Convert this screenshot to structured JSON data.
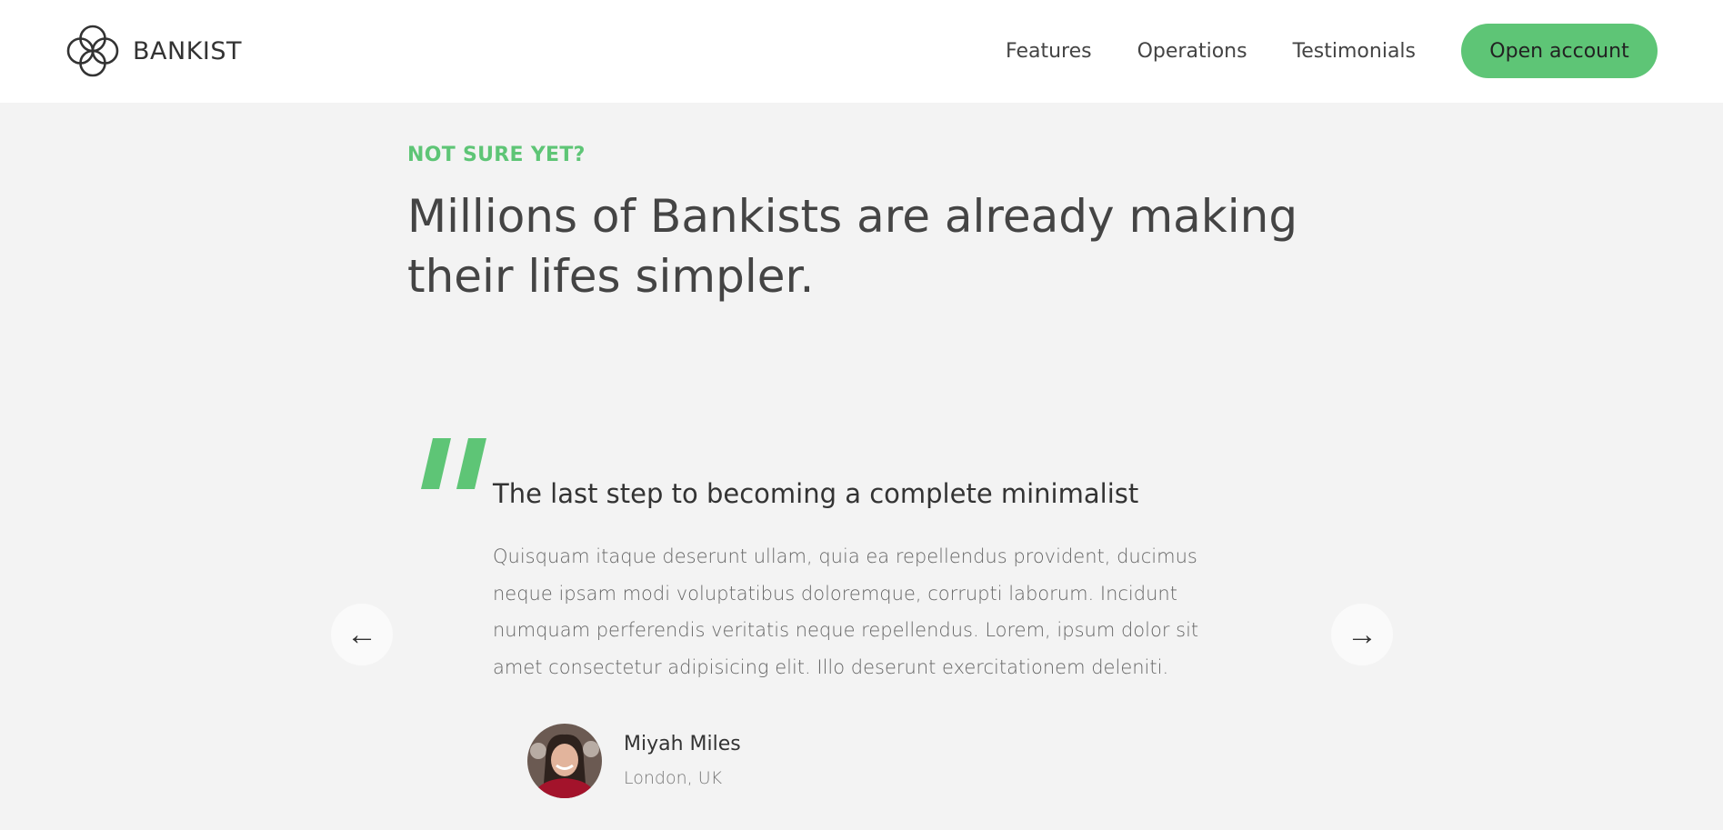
{
  "brand": {
    "name": "BANKIST",
    "accent": "#5ec576"
  },
  "nav": {
    "links": [
      "Features",
      "Operations",
      "Testimonials"
    ],
    "cta": "Open account"
  },
  "section": {
    "eyebrow": "NOT SURE YET?",
    "title": "Millions of Bankists are already making their lifes simpler."
  },
  "testimonial": {
    "quote_icon": "quote-mark-icon",
    "title": "The last step to becoming a complete minimalist",
    "text": "Quisquam itaque deserunt ullam, quia ea repellendus provident, ducimus neque ipsam modi voluptatibus doloremque, corrupti laborum. Incidunt numquam perferendis veritatis neque repellendus. Lorem, ipsum dolor sit amet consectetur adipisicing elit. Illo deserunt exercitationem deleniti.",
    "author": {
      "name": "Miyah Miles",
      "location": "London, UK"
    }
  },
  "slider": {
    "prev_label": "←",
    "next_label": "→"
  }
}
